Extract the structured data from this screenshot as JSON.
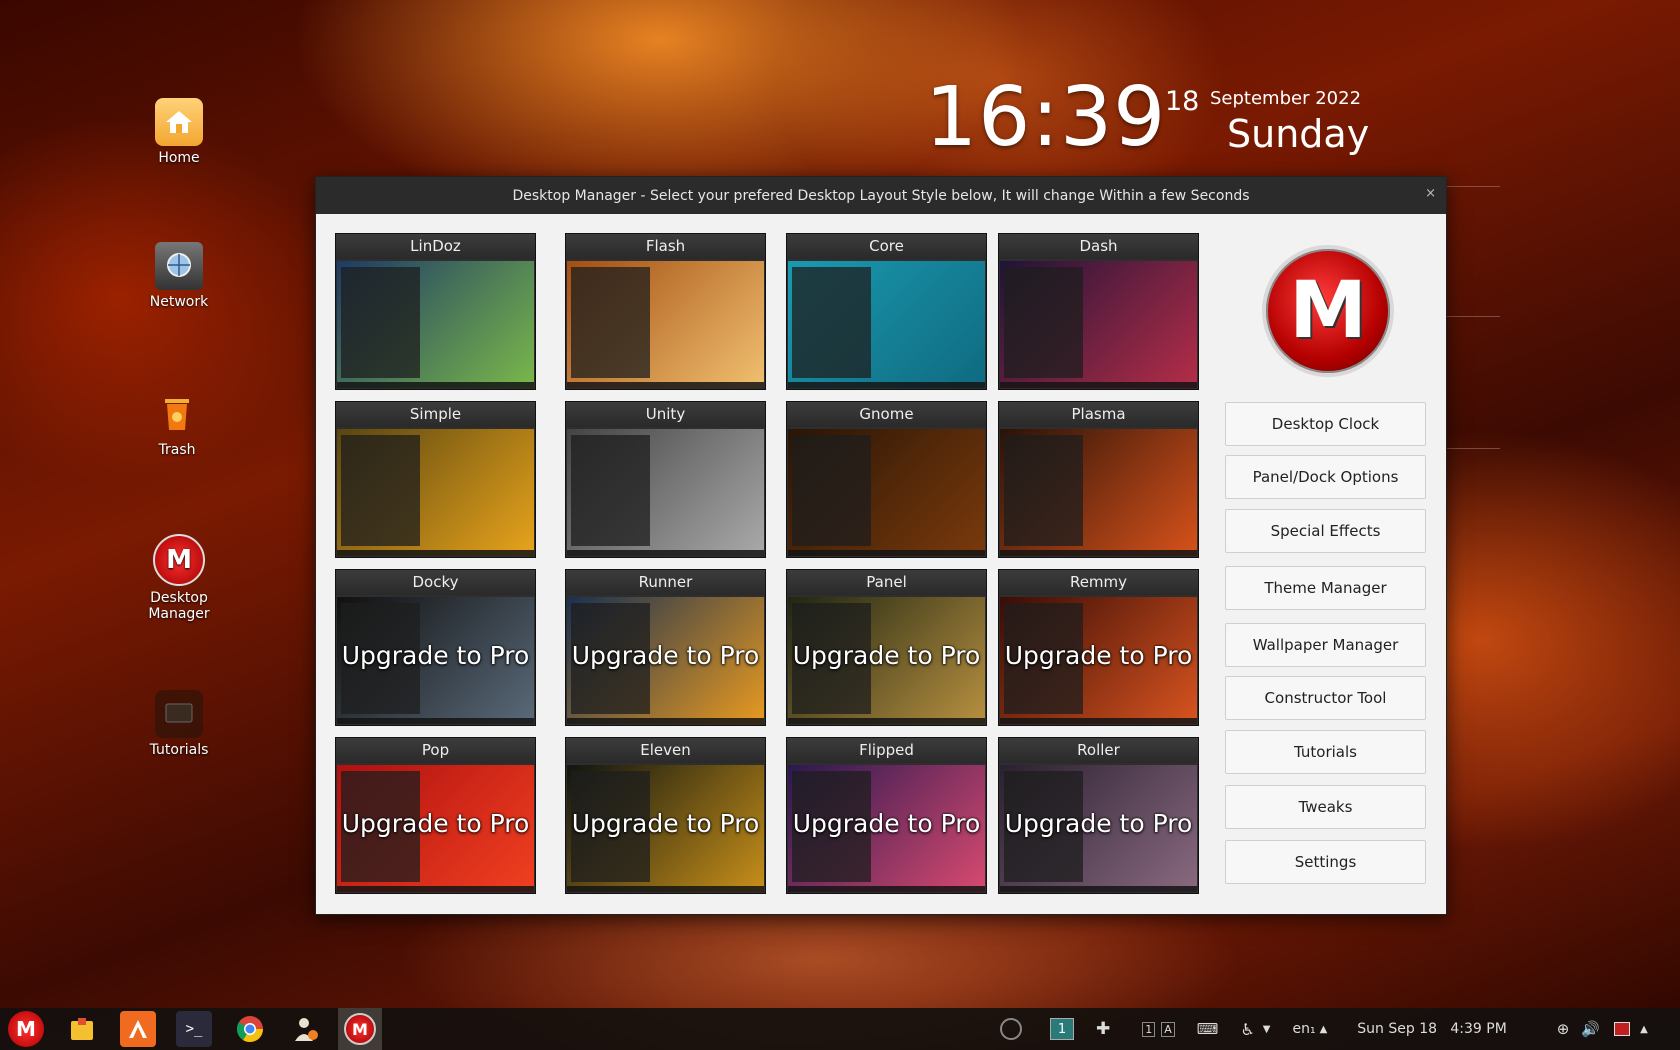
{
  "desktop": {
    "icons": [
      {
        "label": "Home"
      },
      {
        "label": "Network"
      },
      {
        "label": "Trash"
      },
      {
        "label": "Desktop Manager"
      },
      {
        "label": "Tutorials"
      }
    ]
  },
  "clock": {
    "time": "16:39",
    "day": "18",
    "month_year": "September 2022",
    "weekday": "Sunday"
  },
  "dialog": {
    "title": "Desktop Manager - Select your prefered Desktop Layout Style below, It will change Within a few Seconds",
    "close": "×",
    "logo_letter": "M",
    "layouts": [
      {
        "name": "LinDoz",
        "pro": false,
        "bg": "#1d3a66",
        "bg2": "#7ab84a"
      },
      {
        "name": "Flash",
        "pro": false,
        "bg": "#a34e12",
        "bg2": "#f1c070"
      },
      {
        "name": "Core",
        "pro": false,
        "bg": "#1a9ab0",
        "bg2": "#0f6a80"
      },
      {
        "name": "Dash",
        "pro": false,
        "bg": "#201338",
        "bg2": "#b52d48"
      },
      {
        "name": "Simple",
        "pro": false,
        "bg": "#5a4510",
        "bg2": "#e8a41c"
      },
      {
        "name": "Unity",
        "pro": false,
        "bg": "#444",
        "bg2": "#aaa"
      },
      {
        "name": "Gnome",
        "pro": false,
        "bg": "#2a1505",
        "bg2": "#7a3a0c"
      },
      {
        "name": "Plasma",
        "pro": false,
        "bg": "#2a1208",
        "bg2": "#d8521a"
      },
      {
        "name": "Docky",
        "pro": true,
        "bg": "#101010",
        "bg2": "#5a6a7a"
      },
      {
        "name": "Runner",
        "pro": true,
        "bg": "#1a3050",
        "bg2": "#e89a20"
      },
      {
        "name": "Panel",
        "pro": true,
        "bg": "#1f2612",
        "bg2": "#b89040"
      },
      {
        "name": "Remmy",
        "pro": true,
        "bg": "#3a0c05",
        "bg2": "#d85420"
      },
      {
        "name": "Pop",
        "pro": true,
        "bg": "#b01010",
        "bg2": "#f04020"
      },
      {
        "name": "Eleven",
        "pro": true,
        "bg": "#10150f",
        "bg2": "#c8901a"
      },
      {
        "name": "Flipped",
        "pro": true,
        "bg": "#2a1850",
        "bg2": "#d84a70"
      },
      {
        "name": "Roller",
        "pro": true,
        "bg": "#2a2030",
        "bg2": "#8a6a80"
      }
    ],
    "pro_text": "Upgrade to Pro",
    "buttons": [
      "Desktop Clock",
      "Panel/Dock Options",
      "Special Effects",
      "Theme Manager",
      "Wallpaper Manager",
      "Constructor Tool",
      "Tutorials",
      "Tweaks",
      "Settings"
    ]
  },
  "taskbar": {
    "workspace": "1",
    "keyboard_layout": "en₁",
    "datetime": "Sun Sep 18   4:39 PM"
  }
}
